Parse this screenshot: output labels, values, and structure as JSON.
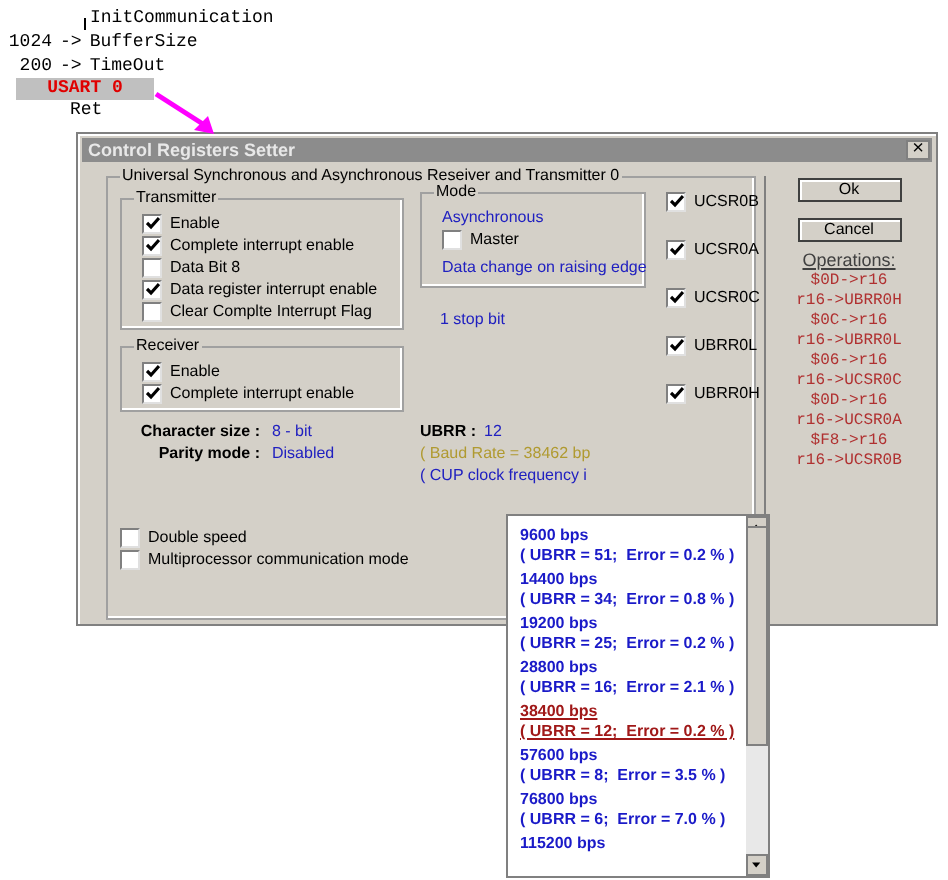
{
  "code_lines": [
    {
      "kind": "label",
      "text": "InitCommunication"
    },
    {
      "kind": "assign",
      "value": "1024",
      "arrow": "->",
      "target": "BufferSize"
    },
    {
      "kind": "assign",
      "value": "200",
      "arrow": "->",
      "target": "TimeOut"
    },
    {
      "kind": "block",
      "text": "USART 0"
    },
    {
      "kind": "ret",
      "text": "Ret"
    }
  ],
  "dialog": {
    "title": "Control Registers Setter",
    "close": "×",
    "group_title": "Universal Synchronous and Asynchronous Reseiver and Transmitter 0",
    "transmitter": {
      "title": "Transmitter",
      "options": [
        {
          "label": "Enable",
          "checked": true
        },
        {
          "label": "Complete interrupt enable",
          "checked": true
        },
        {
          "label": "Data Bit 8",
          "checked": false
        },
        {
          "label": "Data register interrupt enable",
          "checked": true
        },
        {
          "label": "Clear Complte Interrupt Flag",
          "checked": false
        }
      ]
    },
    "mode": {
      "title": "Mode",
      "value": "Asynchronous",
      "master": {
        "label": "Master",
        "checked": false
      },
      "edge": "Data change on raising edge"
    },
    "stop_bits": "1 stop bit",
    "receiver": {
      "title": "Receiver",
      "options": [
        {
          "label": "Enable",
          "checked": true
        },
        {
          "label": "Complete interrupt enable",
          "checked": true
        }
      ]
    },
    "character_size": {
      "label": "Character size :",
      "value": "8 - bit"
    },
    "parity": {
      "label": "Parity mode :",
      "value": "Disabled"
    },
    "ubrr": {
      "label": "UBRR :",
      "value": "12"
    },
    "baud_note": "( Baud Rate = 38462 bp",
    "clock_note": "( CUP clock frequency i",
    "options": [
      {
        "label": "Double speed",
        "checked": false
      },
      {
        "label": "Multiprocessor communication mode",
        "checked": false
      }
    ],
    "registers": [
      {
        "label": "UCSR0B",
        "checked": true
      },
      {
        "label": "UCSR0A",
        "checked": true
      },
      {
        "label": "UCSR0C",
        "checked": true
      },
      {
        "label": "UBRR0L",
        "checked": true
      },
      {
        "label": "UBRR0H",
        "checked": true
      }
    ],
    "buttons": [
      "Ok",
      "Cancel"
    ],
    "operations_title": "Operations:",
    "operations": [
      "$0D->r16",
      "r16->UBRR0H",
      "$0C->r16",
      "r16->UBRR0L",
      "$06->r16",
      "r16->UCSR0C",
      "$0D->r16",
      "r16->UCSR0A",
      "$F8->r16",
      "r16->UCSR0B"
    ]
  },
  "baud_list": [
    {
      "speed": "9600 bps",
      "detail": "( UBRR = 51;  Error = 0.2 % )",
      "selected": false
    },
    {
      "speed": "14400 bps",
      "detail": "( UBRR = 34;  Error = 0.8 % )",
      "selected": false
    },
    {
      "speed": "19200 bps",
      "detail": "( UBRR = 25;  Error = 0.2 % )",
      "selected": false
    },
    {
      "speed": "28800 bps",
      "detail": "( UBRR = 16;  Error = 2.1 % )",
      "selected": false
    },
    {
      "speed": "38400 bps",
      "detail": "( UBRR = 12;  Error = 0.2 % )",
      "selected": true
    },
    {
      "speed": "57600 bps",
      "detail": "( UBRR = 8;  Error = 3.5 % )",
      "selected": false
    },
    {
      "speed": "76800 bps",
      "detail": "( UBRR = 6;  Error = 7.0 % )",
      "selected": false
    },
    {
      "speed": "115200 bps",
      "selected": false
    }
  ]
}
